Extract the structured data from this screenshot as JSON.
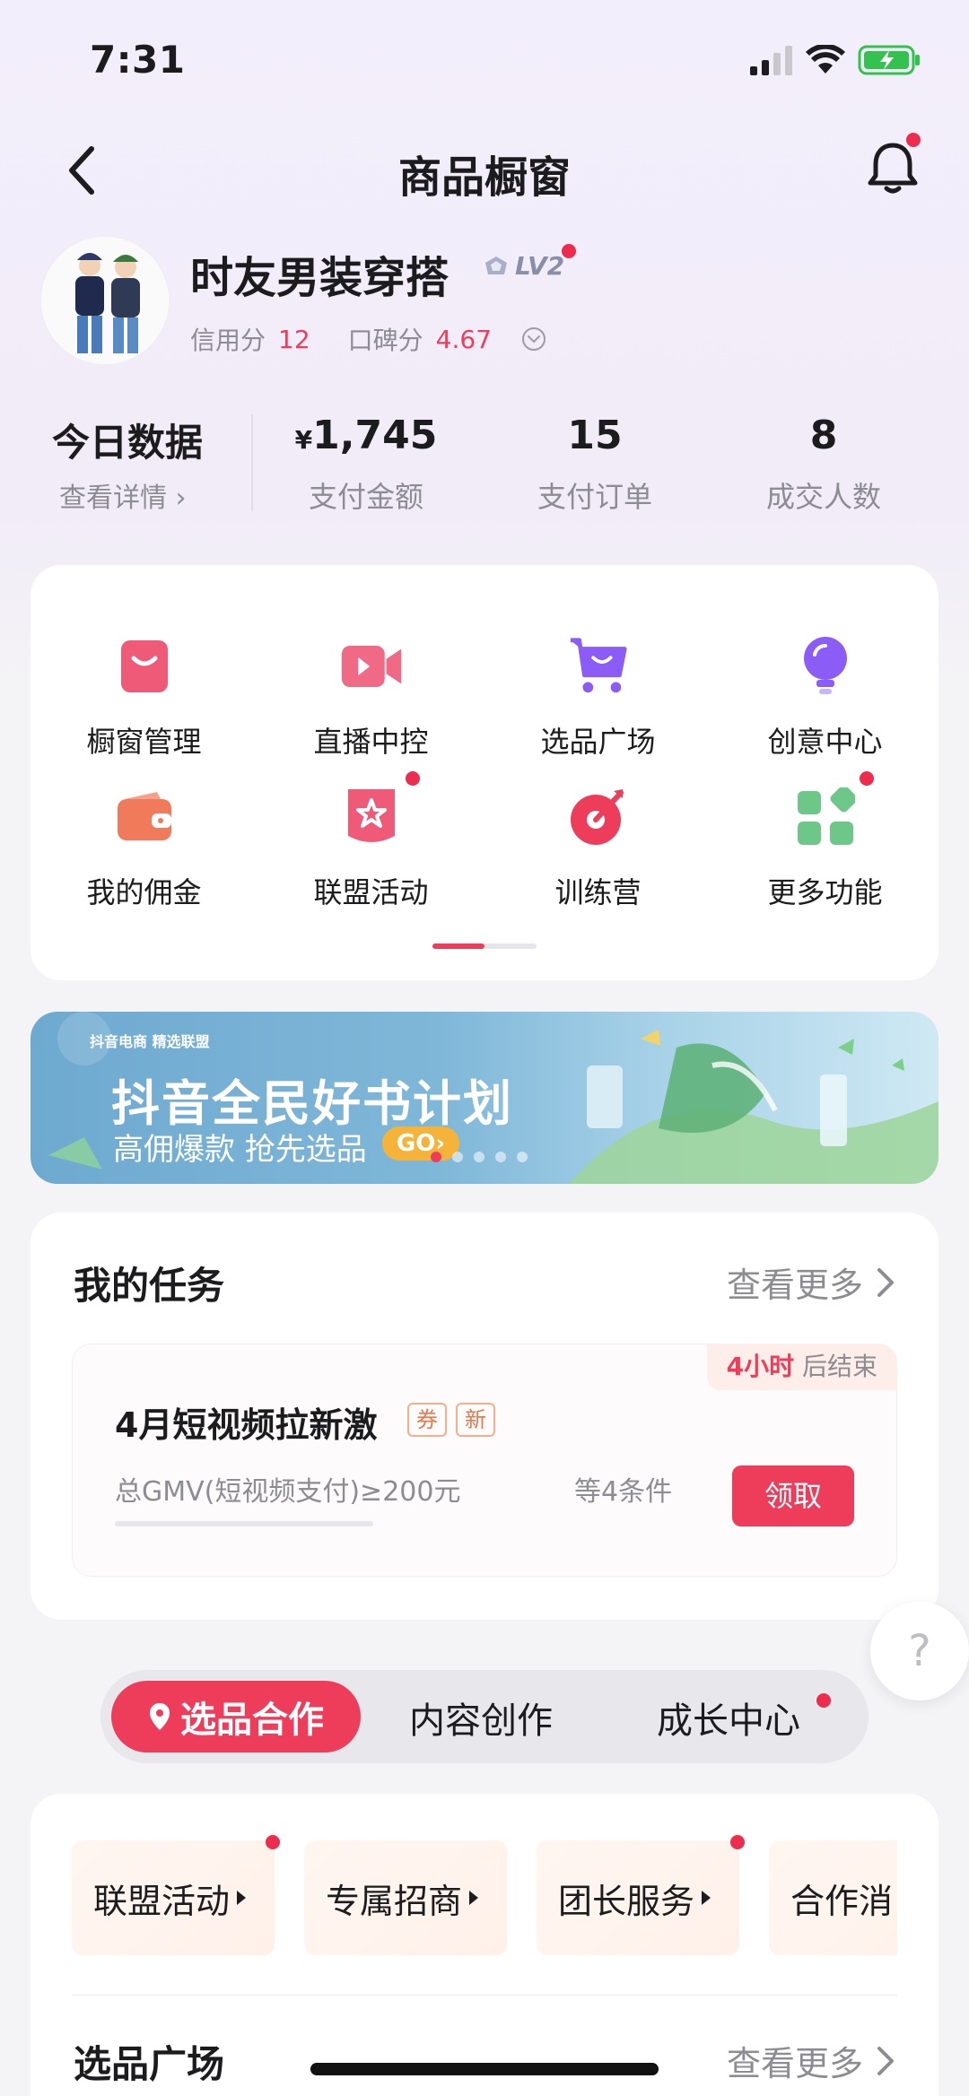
{
  "status_bar": {
    "time": "7:31"
  },
  "header": {
    "title": "商品橱窗"
  },
  "profile": {
    "name": "时友男装穿搭",
    "level": "LV2",
    "credit_label": "信用分",
    "credit_value": "12",
    "reputation_label": "口碑分",
    "reputation_value": "4.67"
  },
  "today": {
    "title": "今日数据",
    "detail_link": "查看详情 ›",
    "stats": [
      {
        "currency": "¥",
        "value": "1,745",
        "label": "支付金额"
      },
      {
        "value": "15",
        "label": "支付订单"
      },
      {
        "value": "8",
        "label": "成交人数"
      }
    ]
  },
  "shortcuts": [
    {
      "label": "橱窗管理",
      "icon": "shop-bag-icon",
      "color": "#ee5a78"
    },
    {
      "label": "直播中控",
      "icon": "video-camera-icon",
      "color": "#f06a86"
    },
    {
      "label": "选品广场",
      "icon": "shopping-cart-icon",
      "color": "#8b5cf6"
    },
    {
      "label": "创意中心",
      "icon": "lightbulb-icon",
      "color": "#8b5cf6"
    },
    {
      "label": "我的佣金",
      "icon": "wallet-icon",
      "color": "#f07a5a"
    },
    {
      "label": "联盟活动",
      "icon": "star-badge-icon",
      "color": "#ee5a78"
    },
    {
      "label": "训练营",
      "icon": "target-icon",
      "color": "#ee3d5a"
    },
    {
      "label": "更多功能",
      "icon": "grid-apps-icon",
      "color": "#6cc788"
    }
  ],
  "banner": {
    "brand": "抖音电商 精选联盟",
    "title": "抖音全民好书计划",
    "subtitle": "高佣爆款 抢先选品",
    "cta": "GO›"
  },
  "tasks": {
    "title": "我的任务",
    "more": "查看更多",
    "item": {
      "timer_hot": "4小时",
      "timer_suffix": "后结束",
      "name": "4月短视频拉新激",
      "tags": [
        "券",
        "新"
      ],
      "condition": "总GMV(短视频支付)≥200元",
      "condition_more": "等4条件",
      "action": "领取"
    }
  },
  "help": {
    "label": "?"
  },
  "segments": {
    "active": "选品合作",
    "tabs": [
      "内容创作",
      "成长中心"
    ]
  },
  "pills": [
    {
      "label": "联盟活动"
    },
    {
      "label": "专属招商"
    },
    {
      "label": "团长服务"
    },
    {
      "label": "合作消"
    }
  ],
  "selection": {
    "title": "选品广场",
    "more": "查看更多"
  }
}
